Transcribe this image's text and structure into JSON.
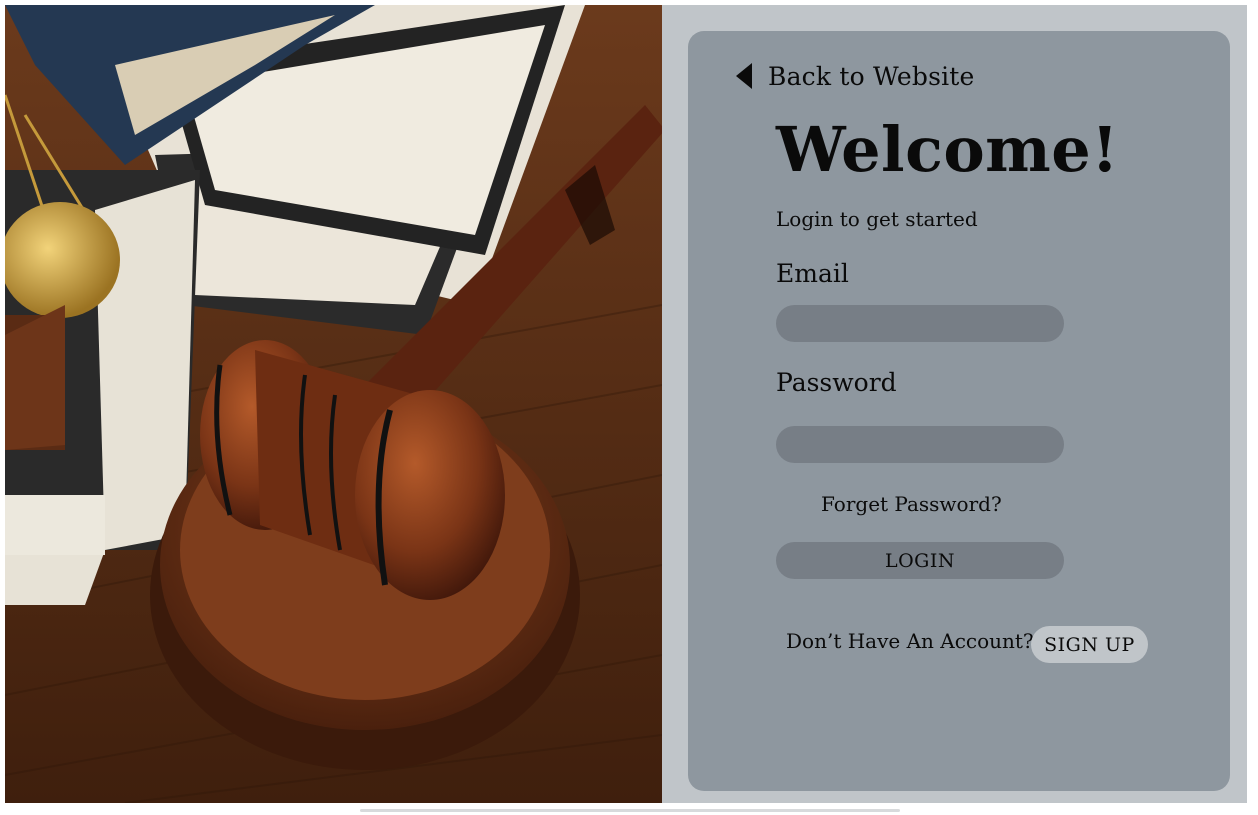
{
  "colors": {
    "frame_bg": "#c0c5c9",
    "card_bg": "#8e979f",
    "input_bg": "#777e86",
    "signup_bg": "#c0c5c9",
    "text": "#0a0a0a"
  },
  "hero_image": {
    "alt": "gavel-books-scales-photo"
  },
  "login": {
    "back_label": "Back to Website",
    "back_icon": "triangle-left-icon",
    "title": "Welcome!",
    "subtitle": "Login to get started",
    "email_label": "Email",
    "email_value": "",
    "password_label": "Password",
    "password_value": "",
    "forgot_label": "Forget Password?",
    "login_button": "LOGIN",
    "no_account_text": "Don’t Have An Account?",
    "signup_button": "SIGN UP"
  }
}
